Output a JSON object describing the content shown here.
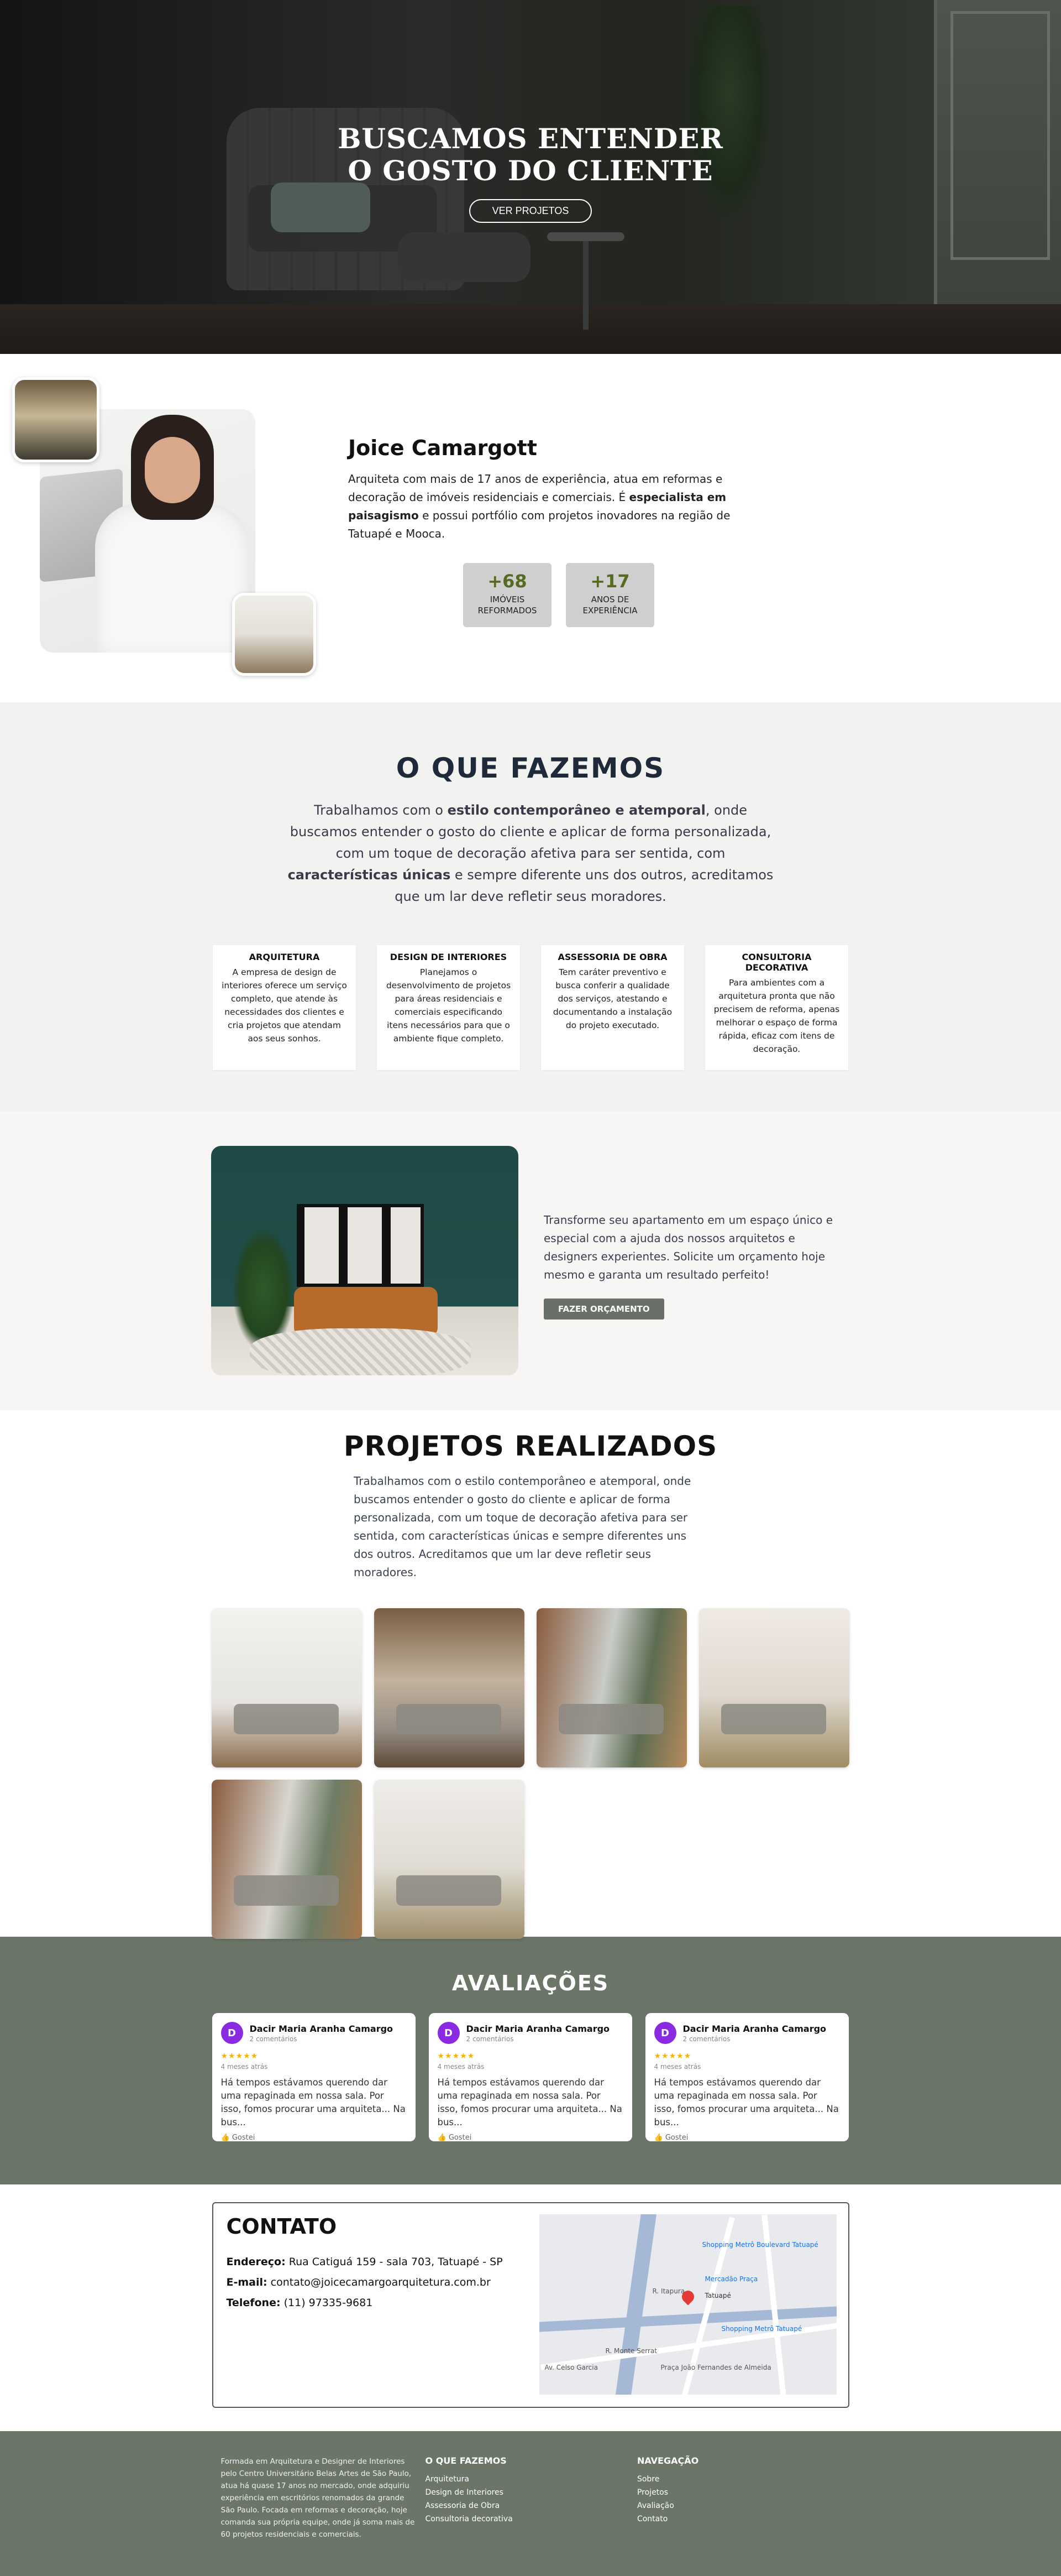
{
  "hero": {
    "title_line1": "BUSCAMOS ENTENDER",
    "title_line2": "O GOSTO DO CLIENTE",
    "cta": "VER PROJETOS"
  },
  "about": {
    "name": "Joice Camargott",
    "paragraph_part1": "Arquiteta com mais de 17 anos de experiência, atua em reformas e decoração de imóveis residenciais e comerciais. É ",
    "paragraph_bold": "especialista em paisagismo",
    "paragraph_part2": " e possui portfólio com projetos inovadores na região de Tatuapé e Mooca.",
    "stats": [
      {
        "num": "+68",
        "label_line1": "IMÓVEIS",
        "label_line2": "REFORMADOS"
      },
      {
        "num": "+17",
        "label_line1": "ANOS DE",
        "label_line2": "EXPERIÊNCIA"
      }
    ]
  },
  "services": {
    "title": "O QUE FAZEMOS",
    "intro_part1": "Trabalhamos com o ",
    "intro_bold1": "estilo contemporâneo e atemporal",
    "intro_part2": ", onde buscamos entender o gosto do cliente e aplicar de forma personalizada, com um toque de decoração afetiva para ser sentida, com ",
    "intro_bold2": "características únicas",
    "intro_part3": " e sempre diferente uns dos outros, acreditamos que um lar deve refletir seus moradores.",
    "cards": [
      {
        "title": "ARQUITETURA",
        "text": "A empresa de design de interiores oferece um serviço completo, que atende às necessidades dos clientes e cria projetos que atendam aos seus sonhos."
      },
      {
        "title": "DESIGN DE INTERIORES",
        "text": "Planejamos o desenvolvimento de projetos para áreas residenciais e comerciais especificando itens necessários para que o ambiente fique completo."
      },
      {
        "title": "ASSESSORIA DE OBRA",
        "text": "Tem caráter preventivo e busca conferir a qualidade dos serviços, atestando e documentando a instalação do projeto executado."
      },
      {
        "title": "CONSULTORIA DECORATIVA",
        "text": "Para ambientes com a arquitetura pronta que não precisem de reforma, apenas melhorar o espaço de forma rápida, eficaz com itens de decoração."
      }
    ]
  },
  "quote": {
    "text": "Transforme seu apartamento em um espaço único e especial com a ajuda dos nossos arquitetos e designers experientes. Solicite um orçamento hoje mesmo e garanta um resultado perfeito!",
    "button": "FAZER ORÇAMENTO"
  },
  "projects": {
    "title": "PROJETOS REALIZADOS",
    "intro": "Trabalhamos com o estilo contemporâneo e atemporal, onde buscamos entender o gosto do cliente e aplicar de forma personalizada, com um toque de decoração afetiva para ser sentida, com características únicas e sempre diferentes uns dos outros. Acreditamos que um lar deve refletir seus moradores."
  },
  "reviews": {
    "title": "AVALIAÇÕES",
    "items": [
      {
        "initial": "D",
        "name": "Dacir Maria Aranha Camargo",
        "sub": "2 comentários",
        "stars": "★★★★★",
        "time": "4 meses atrás",
        "body": "Há tempos estávamos querendo dar uma repaginada em nossa sala. Por isso, fomos procurar uma arquiteta... Na bus...",
        "like": "Gostei"
      },
      {
        "initial": "D",
        "name": "Dacir Maria Aranha Camargo",
        "sub": "2 comentários",
        "stars": "★★★★★",
        "time": "4 meses atrás",
        "body": "Há tempos estávamos querendo dar uma repaginada em nossa sala. Por isso, fomos procurar uma arquiteta... Na bus...",
        "like": "Gostei"
      },
      {
        "initial": "D",
        "name": "Dacir Maria Aranha Camargo",
        "sub": "2 comentários",
        "stars": "★★★★★",
        "time": "4 meses atrás",
        "body": "Há tempos estávamos querendo dar uma repaginada em nossa sala. Por isso, fomos procurar uma arquiteta... Na bus...",
        "like": "Gostei"
      }
    ]
  },
  "contact": {
    "title": "CONTATO",
    "address_label": "Endereço:",
    "address": "Rua Catiguá 159 - sala 703, Tatuapé - SP",
    "email_label": "E-mail:",
    "email": "contato@joicecamargoarquitetura.com.br",
    "phone_label": "Telefone:",
    "phone": "(11) 97335-9681",
    "map_labels": [
      "Tatuapé",
      "Mercadão Praça",
      "Shopping Metrô Tatuapé",
      "Shopping Metrô Boulevard Tatuapé",
      "R. Itapura",
      "Av. Celso Garcia",
      "Praça João Fernandes de Almeida",
      "R. Monte Serrat"
    ]
  },
  "footer": {
    "about": "Formada em Arquitetura e Designer de Interiores pelo Centro Universitário Belas Artes de São Paulo, atua há quase 17 anos no mercado, onde adquiriu experiência em escritórios renomados da grande São Paulo. Focada em reformas e decoração, hoje comanda sua própria equipe, onde já soma mais de 60 projetos residenciais e comerciais.",
    "services_title": "O QUE FAZEMOS",
    "services_links": [
      "Arquitetura",
      "Design de Interiores",
      "Assessoria de Obra",
      "Consultoria decorativa"
    ],
    "nav_title": "NAVEGAÇÃO",
    "nav_links": [
      "Sobre",
      "Projetos",
      "Avaliação",
      "Contato"
    ]
  }
}
